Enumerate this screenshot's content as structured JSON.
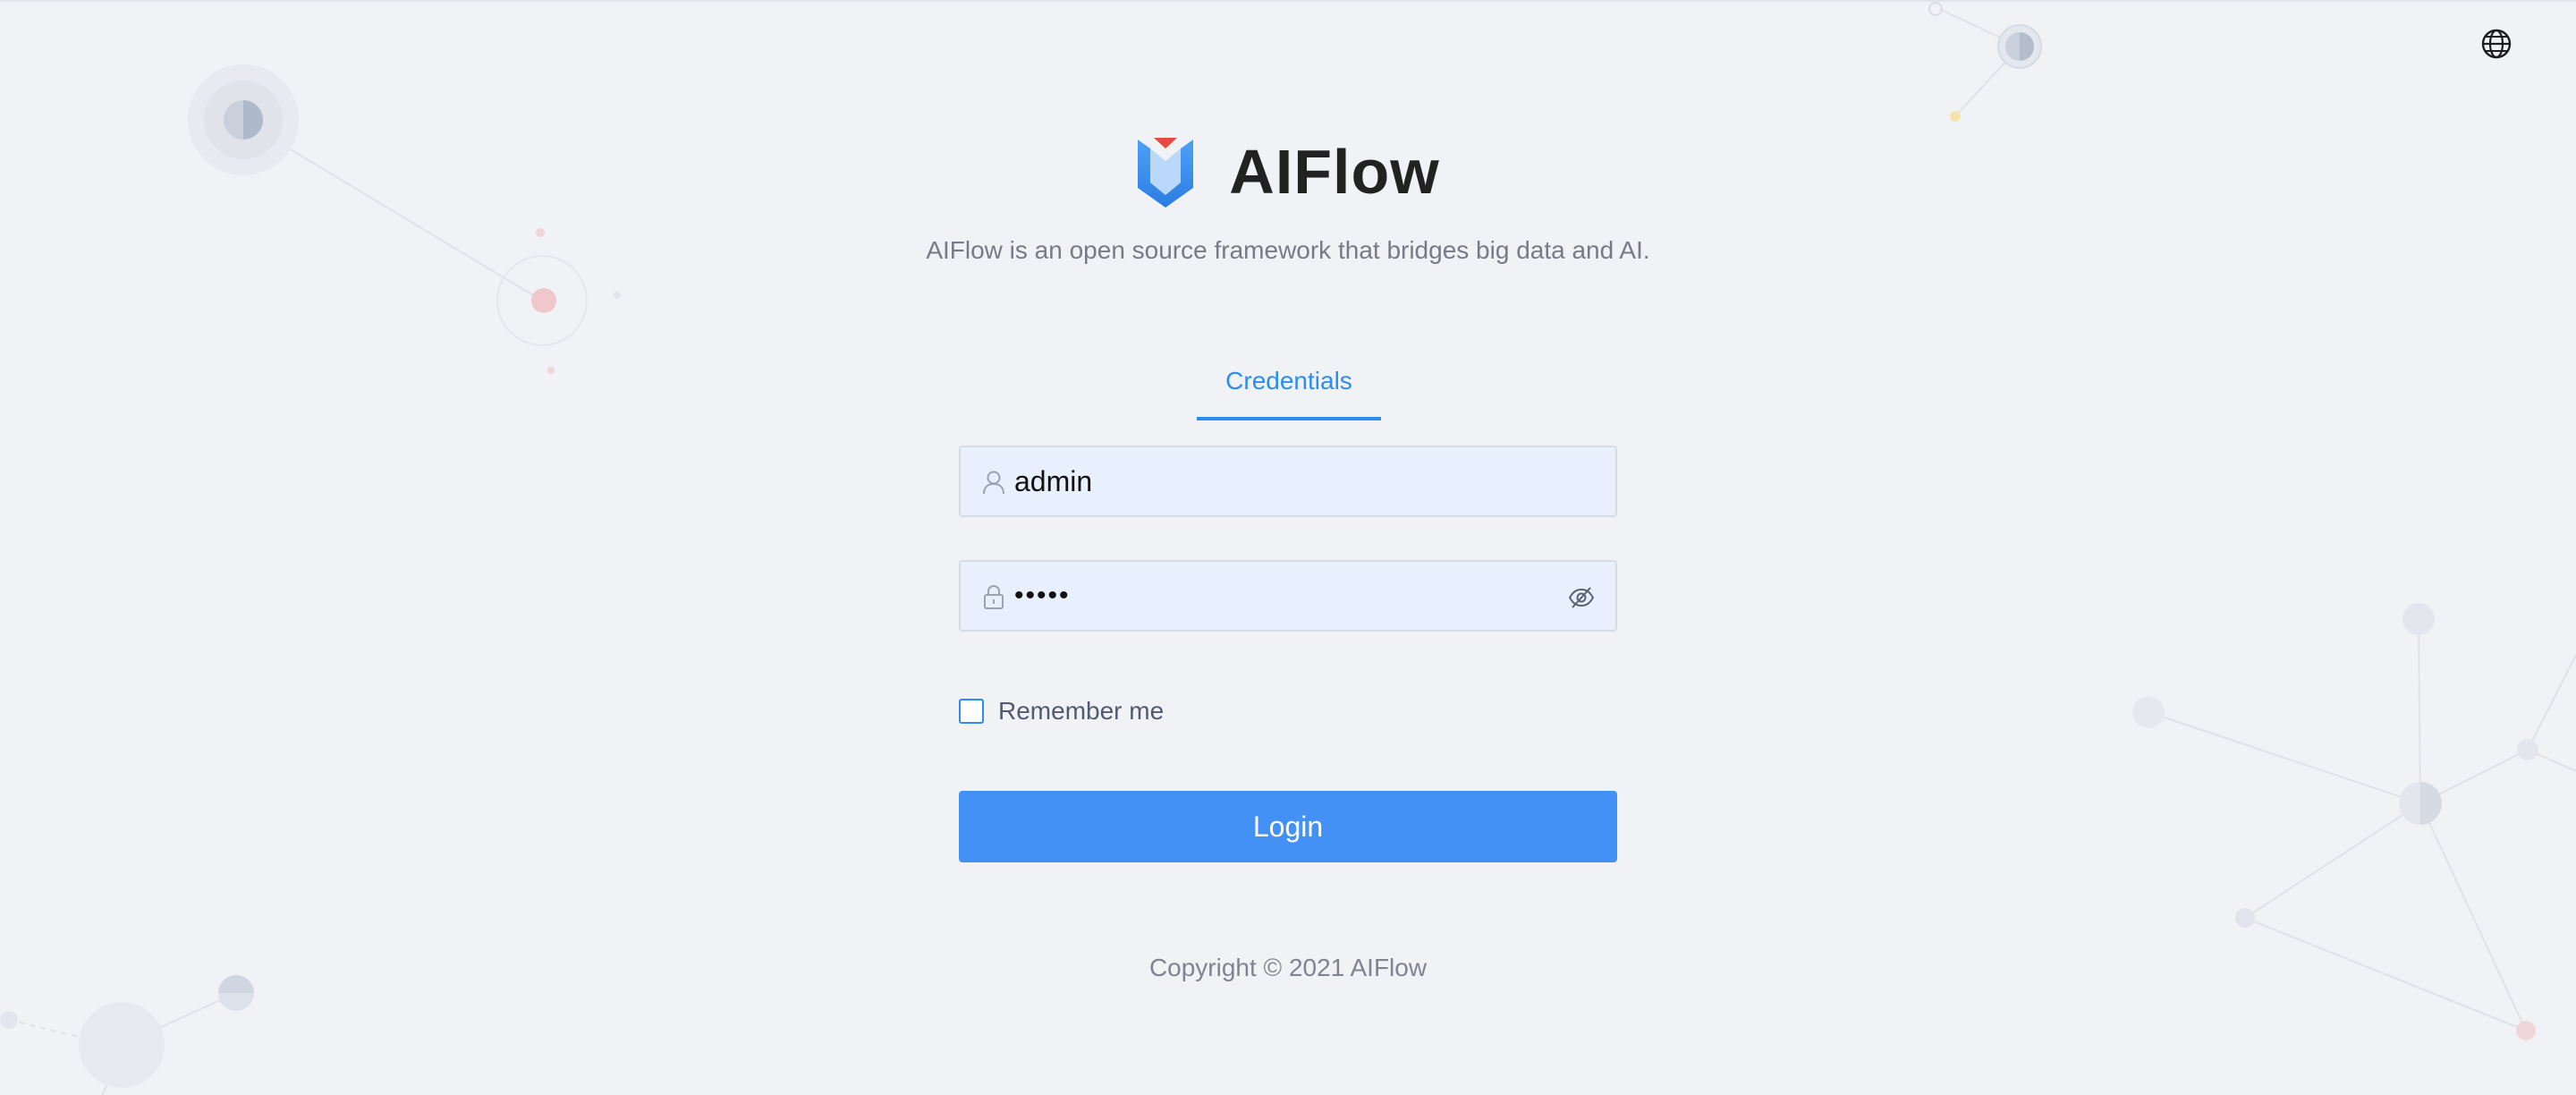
{
  "app": {
    "title": "AIFlow",
    "subtitle": "AIFlow is an open source framework that bridges big data and AI.",
    "copyright": "Copyright © 2021 AIFlow"
  },
  "tabs": [
    {
      "label": "Credentials",
      "active": true
    }
  ],
  "form": {
    "username": {
      "value": "admin",
      "icon": "user-icon"
    },
    "password": {
      "value": "admin",
      "icon": "lock-icon",
      "toggle_icon": "eye-off-icon"
    },
    "remember_label": "Remember me",
    "remember_checked": false,
    "login_label": "Login"
  },
  "header": {
    "language_icon": "globe-icon"
  },
  "colors": {
    "accent": "#2d8cf0",
    "button": "#4491f5",
    "background": "#f1f2f6",
    "input_background": "#e8effd"
  }
}
